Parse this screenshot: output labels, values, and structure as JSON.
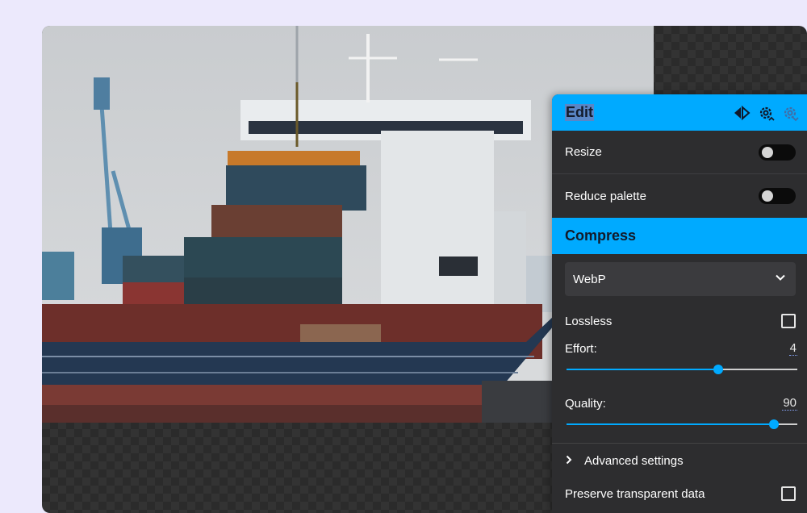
{
  "panel": {
    "edit": {
      "title": "Edit",
      "resize_label": "Resize",
      "reduce_palette_label": "Reduce palette"
    },
    "compress": {
      "title": "Compress",
      "format": "WebP",
      "lossless_label": "Lossless",
      "effort_label": "Effort:",
      "effort_value": "4",
      "effort_fraction": 0.659,
      "quality_label": "Quality:",
      "quality_value": "90",
      "quality_fraction": 0.9,
      "advanced_label": "Advanced settings",
      "preserve_label": "Preserve transparent data"
    }
  },
  "colors": {
    "accent": "#00aaff",
    "background": "#ece9fc",
    "panel": "#2d2d2f"
  },
  "icons": [
    "split-view-icon",
    "gear-upload-icon",
    "gear-download-icon",
    "chevron-down-icon",
    "chevron-right-icon"
  ]
}
